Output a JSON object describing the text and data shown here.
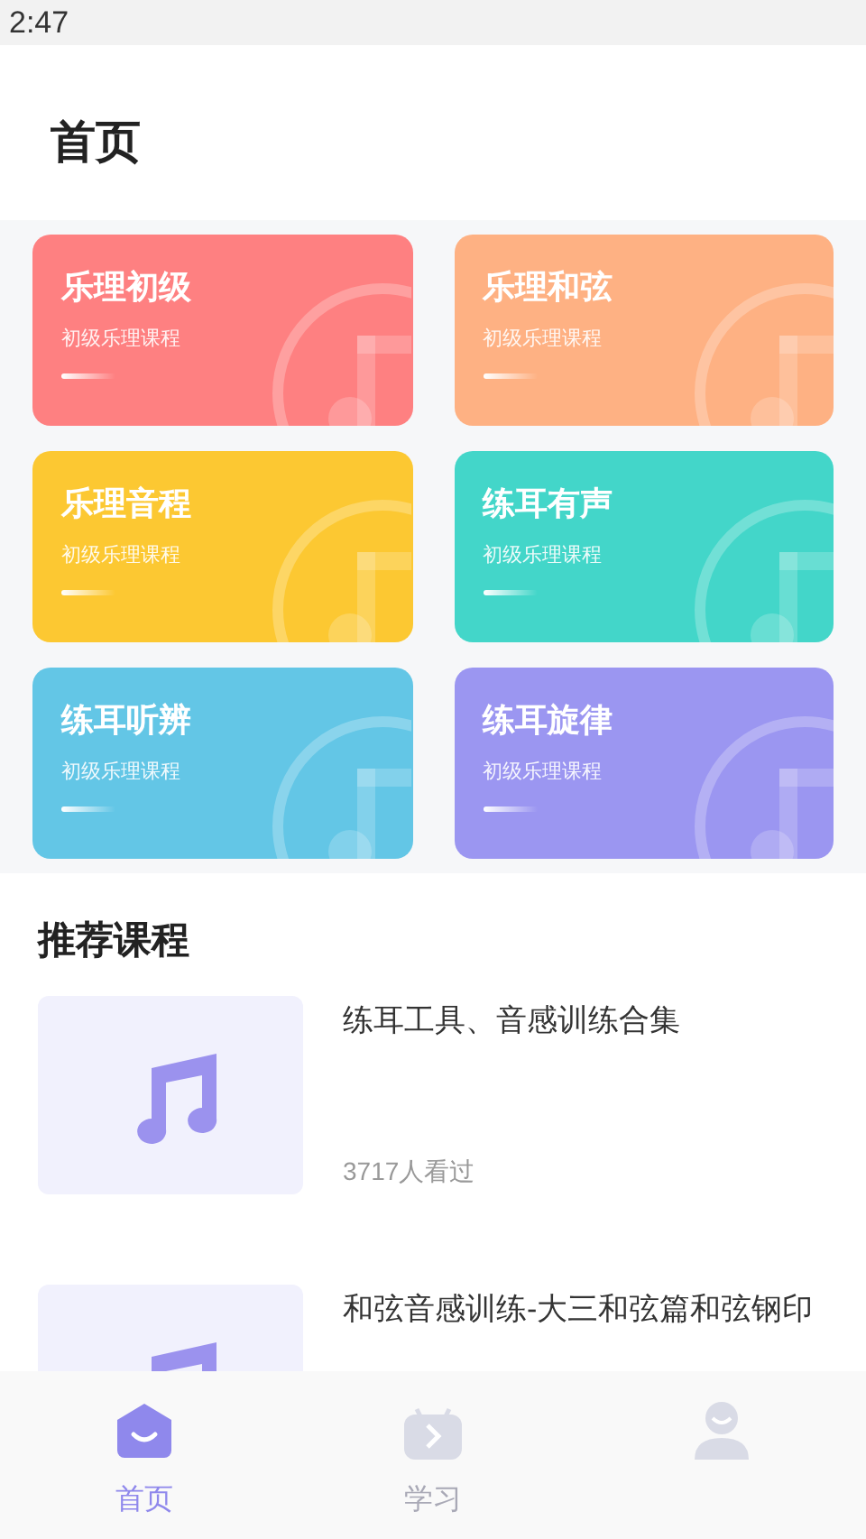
{
  "status_bar": {
    "time": "2:47"
  },
  "header": {
    "title": "首页"
  },
  "categories": [
    {
      "title": "乐理初级",
      "subtitle": "初级乐理课程",
      "color": "#fe8081"
    },
    {
      "title": "乐理和弦",
      "subtitle": "初级乐理课程",
      "color": "#feb183"
    },
    {
      "title": "乐理音程",
      "subtitle": "初级乐理课程",
      "color": "#fcc832"
    },
    {
      "title": "练耳有声",
      "subtitle": "初级乐理课程",
      "color": "#43d6c9"
    },
    {
      "title": "练耳听辨",
      "subtitle": "初级乐理课程",
      "color": "#63c6e6"
    },
    {
      "title": "练耳旋律",
      "subtitle": "初级乐理课程",
      "color": "#9b96f1"
    }
  ],
  "recommended": {
    "title": "推荐课程",
    "courses": [
      {
        "title": "练耳工具、音感训练合集",
        "views": "3717人看过"
      },
      {
        "title": "和弦音感训练-大三和弦篇和弦钢印"
      }
    ]
  },
  "tabs": [
    {
      "kind": "home",
      "label": "首页",
      "selected": true
    },
    {
      "kind": "study",
      "label": "学习",
      "selected": false
    },
    {
      "kind": "profile",
      "selected": false
    }
  ]
}
